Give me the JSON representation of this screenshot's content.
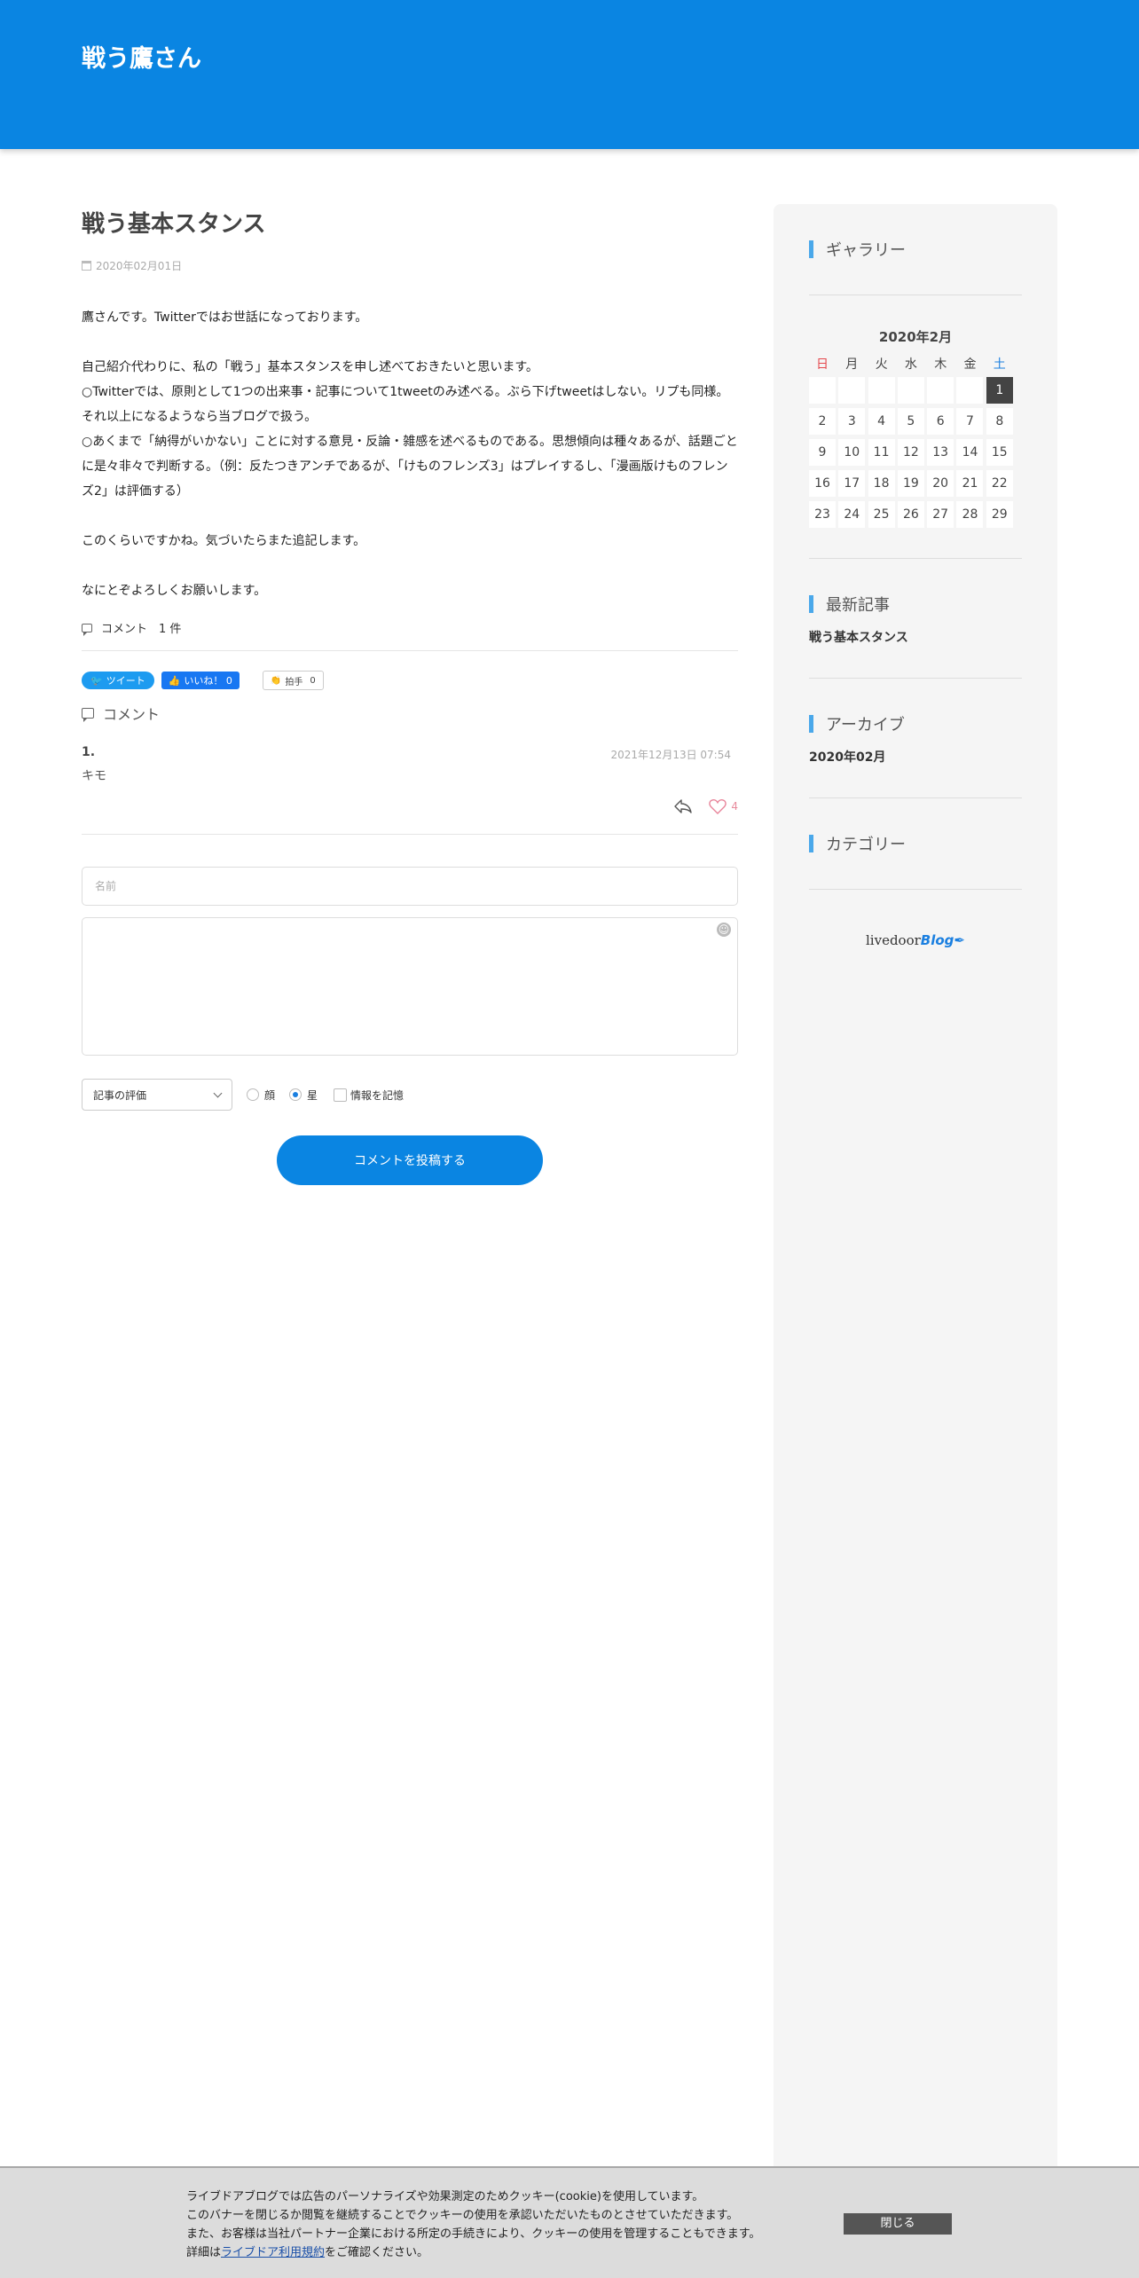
{
  "header": {
    "site_title": "戦う鷹さん"
  },
  "post": {
    "title": "戦う基本スタンス",
    "date": "2020年02月01日",
    "paragraphs": [
      "鷹さんです。Twitterではお世話になっております。",
      "",
      "自己紹介代わりに、私の「戦う」基本スタンスを申し述べておきたいと思います。",
      "○Twitterでは、原則として1つの出来事・記事について1tweetのみ述べる。ぶら下げtweetはしない。リプも同様。それ以上になるようなら当ブログで扱う。",
      "○あくまで「納得がいかない」ことに対する意見・反論・雑感を述べるものである。思想傾向は種々あるが、話題ごとに是々非々で判断する。（例：反たつきアンチであるが、「けものフレンズ3」はプレイするし、「漫画版けものフレンズ2」は評価する）",
      "",
      "このくらいですかね。気づいたらまた追記します。",
      "",
      "なにとぞよろしくお願いします。"
    ],
    "comment_count_label": "コメント　1 件"
  },
  "share": {
    "tweet_label": "ツイート",
    "like_label": "いいね！ 0",
    "clap_label": "拍手",
    "clap_count": "0"
  },
  "comments": {
    "heading": "コメント",
    "items": [
      {
        "number": "1.",
        "date": "2021年12月13日 07:54",
        "text": "キモ",
        "likes": "4"
      }
    ]
  },
  "form": {
    "name_placeholder": "名前",
    "rating_select": "記事の評価",
    "radio_face": "顔",
    "radio_star": "星",
    "remember_label": "情報を記憶",
    "submit_label": "コメントを投稿する"
  },
  "sidebar": {
    "gallery_title": "ギャラリー",
    "calendar": {
      "title": "2020年2月",
      "weekdays": [
        "日",
        "月",
        "火",
        "水",
        "木",
        "金",
        "土"
      ],
      "rows": [
        [
          "",
          "",
          "",
          "",
          "",
          "",
          "1"
        ],
        [
          "2",
          "3",
          "4",
          "5",
          "6",
          "7",
          "8"
        ],
        [
          "9",
          "10",
          "11",
          "12",
          "13",
          "14",
          "15"
        ],
        [
          "16",
          "17",
          "18",
          "19",
          "20",
          "21",
          "22"
        ],
        [
          "23",
          "24",
          "25",
          "26",
          "27",
          "28",
          "29"
        ]
      ],
      "highlighted_day": "1"
    },
    "recent_title": "最新記事",
    "recent_item": "戦う基本スタンス",
    "archive_title": "アーカイブ",
    "archive_item": "2020年02月",
    "category_title": "カテゴリー",
    "logo_text_1": "livedoor",
    "logo_text_2": "Blog"
  },
  "cookie": {
    "line1": "ライブドアブログでは広告のパーソナライズや効果測定のためクッキー(cookie)を使用しています。",
    "line2": "このバナーを閉じるか閲覧を継続することでクッキーの使用を承認いただいたものとさせていただきます。",
    "line3": "また、お客様は当社パートナー企業における所定の手続きにより、クッキーの使用を管理することもできます。",
    "line4_prefix": "詳細は",
    "line4_link": "ライブドア利用規約",
    "line4_suffix": "をご確認ください。",
    "close_label": "閉じる"
  },
  "colors": {
    "header_bg": "#0a85e2",
    "accent": "#4aa8ea",
    "sunday": "#e5484d",
    "saturday": "#1a7fe0"
  }
}
